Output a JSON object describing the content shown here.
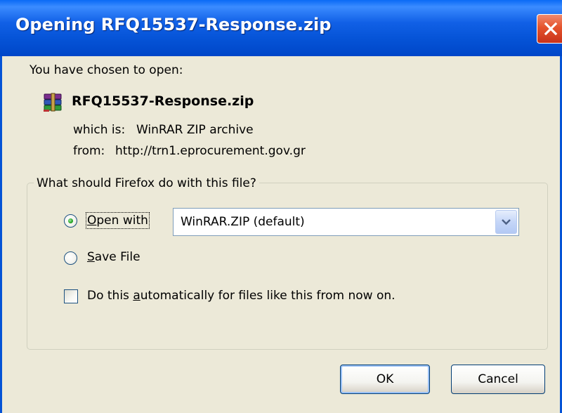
{
  "window": {
    "title": "Opening RFQ15537-Response.zip"
  },
  "intro": "You have chosen to open:",
  "file": {
    "name": "RFQ15537-Response.zip",
    "which_label": "which is:",
    "which_value": "WinRAR ZIP archive",
    "from_label": "from:",
    "from_value": "http://trn1.eprocurement.gov.gr",
    "icon": "winrar-archive-icon"
  },
  "group": {
    "legend": "What should Firefox do with this file?",
    "open_with": {
      "label": "Open with",
      "selected": true
    },
    "open_with_app": "WinRAR.ZIP (default)",
    "save_file": {
      "label": "Save File",
      "selected": false
    },
    "auto": {
      "label": "Do this automatically for files like this from now on.",
      "checked": false
    }
  },
  "buttons": {
    "ok": "OK",
    "cancel": "Cancel"
  }
}
